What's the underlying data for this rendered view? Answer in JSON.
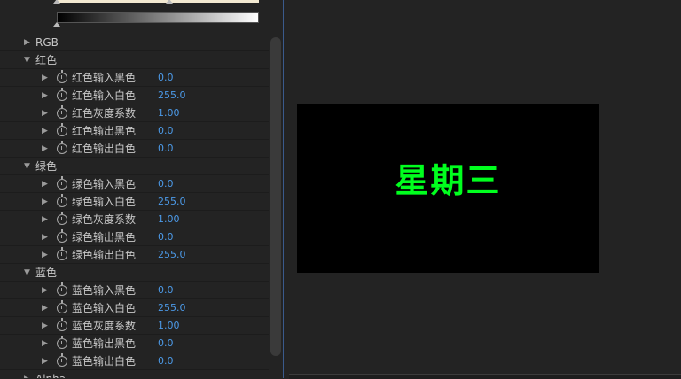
{
  "effect_controls": {
    "groups": [
      {
        "label": "RGB",
        "expanded": false,
        "properties": []
      },
      {
        "label": "红色",
        "expanded": true,
        "properties": [
          {
            "label": "红色输入黑色",
            "value": "0.0"
          },
          {
            "label": "红色输入白色",
            "value": "255.0"
          },
          {
            "label": "红色灰度系数",
            "value": "1.00"
          },
          {
            "label": "红色输出黑色",
            "value": "0.0"
          },
          {
            "label": "红色输出白色",
            "value": "0.0"
          }
        ]
      },
      {
        "label": "绿色",
        "expanded": true,
        "properties": [
          {
            "label": "绿色输入黑色",
            "value": "0.0"
          },
          {
            "label": "绿色输入白色",
            "value": "255.0"
          },
          {
            "label": "绿色灰度系数",
            "value": "1.00"
          },
          {
            "label": "绿色输出黑色",
            "value": "0.0"
          },
          {
            "label": "绿色输出白色",
            "value": "255.0"
          }
        ]
      },
      {
        "label": "蓝色",
        "expanded": true,
        "properties": [
          {
            "label": "蓝色输入黑色",
            "value": "0.0"
          },
          {
            "label": "蓝色输入白色",
            "value": "255.0"
          },
          {
            "label": "蓝色灰度系数",
            "value": "1.00"
          },
          {
            "label": "蓝色输出黑色",
            "value": "0.0"
          },
          {
            "label": "蓝色输出白色",
            "value": "0.0"
          }
        ]
      },
      {
        "label": "Alpha",
        "expanded": false,
        "properties": []
      }
    ],
    "icons": {
      "collapsed": "triangle-right-icon",
      "expanded": "triangle-down-icon",
      "stopwatch": "stopwatch-icon"
    }
  },
  "monitor": {
    "text": "星期三",
    "text_color": "#00ff1e",
    "background_color": "#000000"
  },
  "colors": {
    "value_blue": "#4c9ae8",
    "panel_bg": "#232323"
  }
}
